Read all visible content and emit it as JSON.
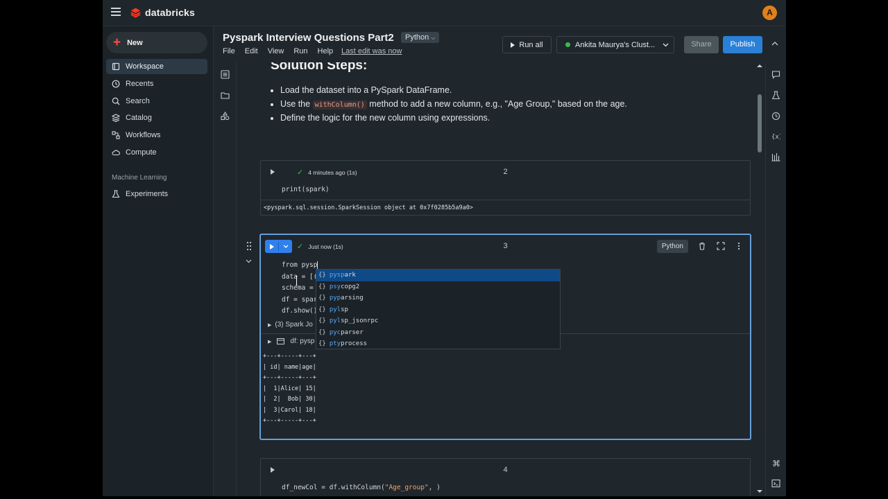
{
  "app": {
    "logo_text": "databricks",
    "avatar_letter": "A",
    "accent": "#2a7fd6",
    "brand_color": "#ff3621"
  },
  "sidebar": {
    "new_label": "New",
    "items": [
      {
        "label": "Workspace",
        "icon": "workspace-icon",
        "active": true
      },
      {
        "label": "Recents",
        "icon": "clock-icon"
      },
      {
        "label": "Search",
        "icon": "search-icon"
      },
      {
        "label": "Catalog",
        "icon": "catalog-icon"
      },
      {
        "label": "Workflows",
        "icon": "workflows-icon"
      },
      {
        "label": "Compute",
        "icon": "cloud-icon"
      }
    ],
    "section_label": "Machine Learning",
    "ml_items": [
      {
        "label": "Experiments",
        "icon": "flask-icon"
      }
    ]
  },
  "notebook": {
    "title": "Pyspark Interview Questions Part2",
    "language": "Python",
    "menus": [
      "File",
      "Edit",
      "View",
      "Run",
      "Help"
    ],
    "last_edit": "Last edit was now",
    "run_all_label": "Run all",
    "cluster_label": "Ankita Maurya's Clust...",
    "share_label": "Share",
    "publish_label": "Publish"
  },
  "markdown": {
    "heading": "Solution Steps:",
    "bullet1": "Load the dataset into a PySpark DataFrame.",
    "bullet2_pre": "Use the ",
    "bullet2_code": "withColumn()",
    "bullet2_post": " method to add a new column, e.g., \"Age Group,\" based on the age.",
    "bullet3": "Define the logic for the new column using expressions."
  },
  "cell2": {
    "number": "2",
    "status": "4 minutes ago (1s)",
    "code": "print(spark)",
    "output": "<pyspark.sql.session.SparkSession object at 0x7f0285b5a9a0>"
  },
  "cell3": {
    "number": "3",
    "status": "Just now (1s)",
    "language": "Python",
    "code_lines": [
      "from pysp",
      "data = [(",
      "schema = ",
      "df = spar",
      "df.show()"
    ],
    "spark_jobs": "(3) Spark Jo",
    "df_label": "df:  pysp",
    "output_lines": [
      "+---+-----+---+",
      "| id| name|age|",
      "+---+-----+---+",
      "|  1|Alice| 15|",
      "|  2|  Bob| 30|",
      "|  3|Carol| 18|",
      "+---+-----+---+"
    ]
  },
  "autocomplete": {
    "items": [
      {
        "match": "pysp",
        "rest": "ark",
        "selected": true
      },
      {
        "match": "psy",
        "rest": "copg2"
      },
      {
        "match": "pyp",
        "rest": "arsing"
      },
      {
        "match": "pyl",
        "rest": "sp"
      },
      {
        "match": "pyl",
        "rest": "sp_jsonrpc"
      },
      {
        "match": "pyc",
        "rest": "parser"
      },
      {
        "match": "pty",
        "rest": "process"
      }
    ]
  },
  "cell4": {
    "number": "4",
    "code_pre": "df_newCol = df.withColumn(",
    "code_str": "\"Age_group\"",
    "code_post": ", )"
  }
}
